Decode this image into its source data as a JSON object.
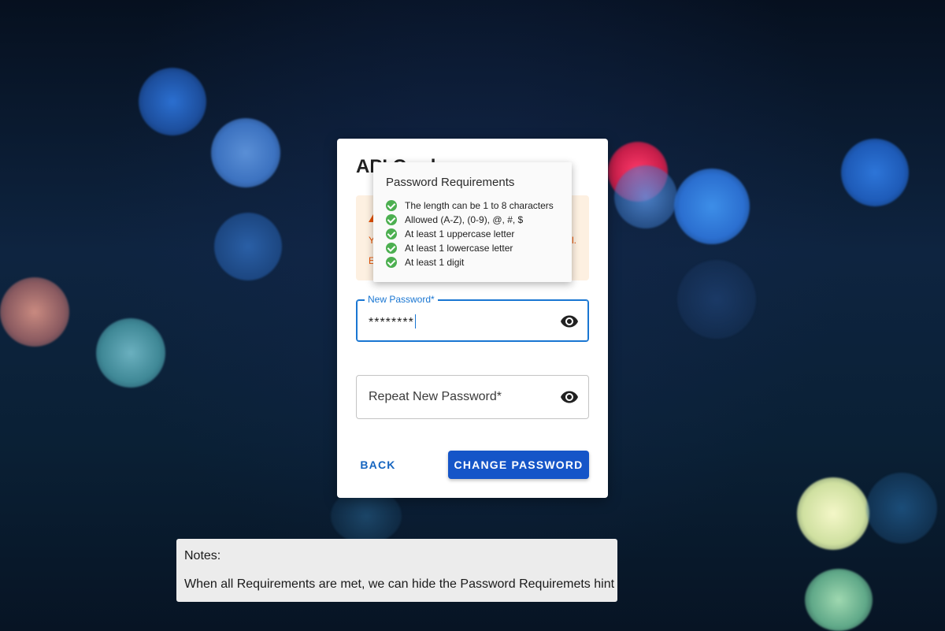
{
  "background": {
    "colors": {
      "deep": "#06101f",
      "mid": "#0e2440"
    }
  },
  "dialog": {
    "title": "API Cred",
    "alert": {
      "icon": "warning-icon",
      "line1": "Y",
      "line2": "E",
      "tail": "l.",
      "color": "#e65100",
      "background": "#fdf0e1"
    },
    "new_password": {
      "label": "New Password*",
      "value": "********",
      "icon": "visibility-icon"
    },
    "repeat_password": {
      "placeholder": "Repeat New Password*",
      "icon": "visibility-icon"
    },
    "back_label": "BACK",
    "change_label": "CHANGE PASSWORD",
    "accent": "#1555c8"
  },
  "requirements": {
    "title": "Password Requirements",
    "items": [
      {
        "text": "The length can be 1 to 8 characters",
        "icon": "check-circle-icon",
        "met": true
      },
      {
        "text": "Allowed (A-Z), (0-9), @, #, $",
        "icon": "check-circle-icon",
        "met": true
      },
      {
        "text": "At least 1 uppercase letter",
        "icon": "check-circle-icon",
        "met": true
      },
      {
        "text": "At least 1 lowercase letter",
        "icon": "check-circle-icon",
        "met": true
      },
      {
        "text": "At least 1 digit",
        "icon": "check-circle-icon",
        "met": true
      }
    ],
    "check_color": "#4caf50"
  },
  "notes": {
    "title": "Notes:",
    "body": "When all Requirements are met, we can hide the Password Requiremets hint"
  }
}
